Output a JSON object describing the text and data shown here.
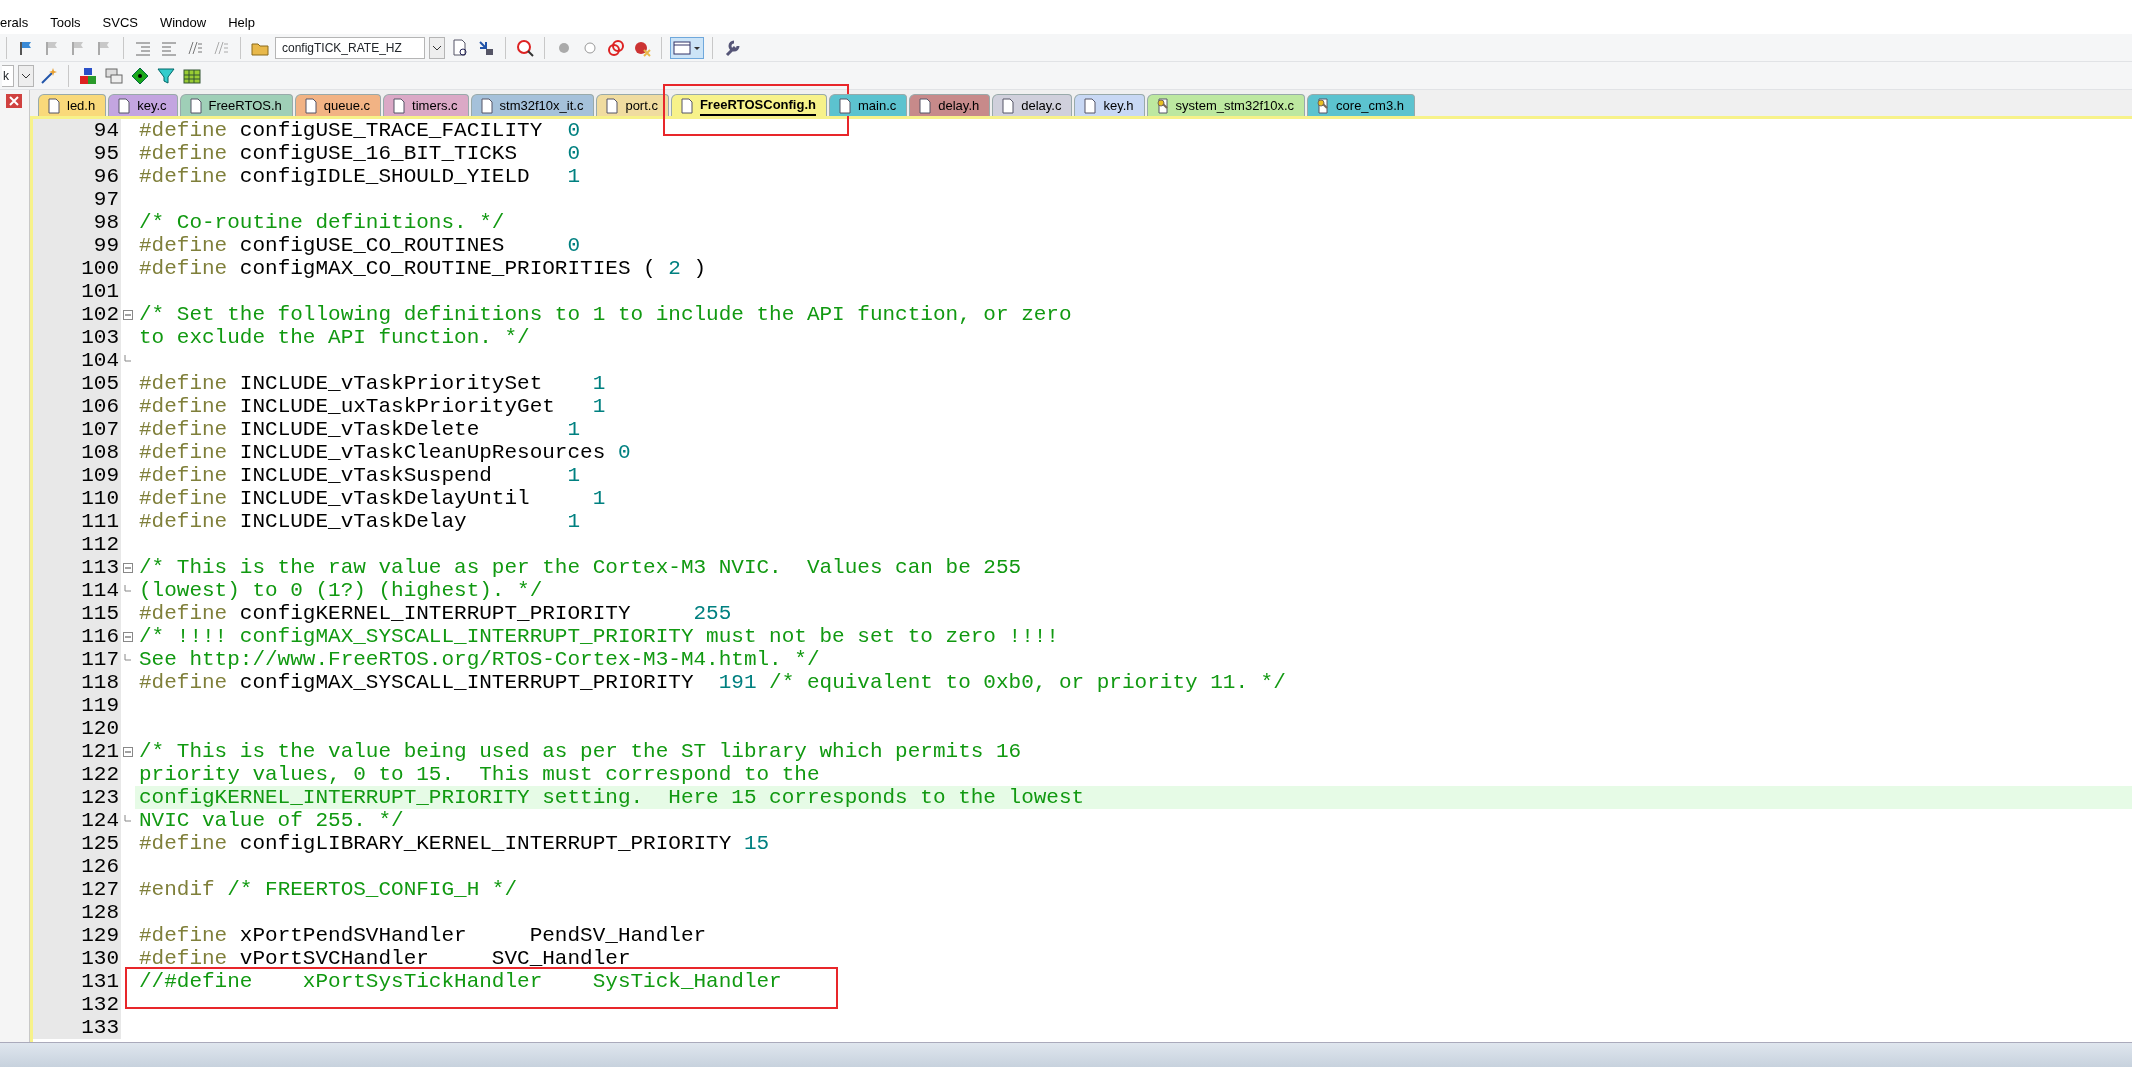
{
  "menu": [
    "erals",
    "Tools",
    "SVCS",
    "Window",
    "Help"
  ],
  "toolbar": {
    "find_combo": "configTICK_RATE_HZ",
    "target_combo": "k"
  },
  "tabs": [
    {
      "label": "led.h",
      "kind": "file",
      "color": "#f9d97a",
      "selected": false,
      "boxed": false
    },
    {
      "label": "key.c",
      "kind": "file",
      "color": "#c3a5e0",
      "selected": false,
      "boxed": false
    },
    {
      "label": "FreeRTOS.h",
      "kind": "file",
      "color": "#9fcfb7",
      "selected": false,
      "boxed": false
    },
    {
      "label": "queue.c",
      "kind": "file",
      "color": "#f2b384",
      "selected": false,
      "boxed": false
    },
    {
      "label": "timers.c",
      "kind": "file",
      "color": "#dba9c6",
      "selected": false,
      "boxed": false
    },
    {
      "label": "stm32f10x_it.c",
      "kind": "file",
      "color": "#a5c1da",
      "selected": false,
      "boxed": false
    },
    {
      "label": "port.c",
      "kind": "file",
      "color": "#f0dca0",
      "selected": false,
      "boxed": false
    },
    {
      "label": "FreeRTOSConfig.h",
      "kind": "file",
      "color": "#f7f28a",
      "selected": true,
      "boxed": true
    },
    {
      "label": "main.c",
      "kind": "file",
      "color": "#5cc3cf",
      "selected": false,
      "boxed": false
    },
    {
      "label": "delay.h",
      "kind": "file",
      "color": "#c78a8a",
      "selected": false,
      "boxed": false
    },
    {
      "label": "delay.c",
      "kind": "file",
      "color": "#d0d0dc",
      "selected": false,
      "boxed": false
    },
    {
      "label": "key.h",
      "kind": "file",
      "color": "#c8d8f4",
      "selected": false,
      "boxed": false
    },
    {
      "label": "system_stm32f10x.c",
      "kind": "key",
      "color": "#bde8a0",
      "selected": false,
      "boxed": false
    },
    {
      "label": "core_cm3.h",
      "kind": "key",
      "color": "#5cc3cf",
      "selected": false,
      "boxed": false
    }
  ],
  "lines": [
    {
      "number": "94",
      "current": false,
      "boxed": false,
      "segments": [
        {
          "kind": "pp",
          "text": "#define"
        },
        {
          "kind": "id",
          "text": " configUSE_TRACE_FACILITY  "
        },
        {
          "kind": "num",
          "text": "0"
        }
      ]
    },
    {
      "number": "95",
      "current": false,
      "boxed": false,
      "segments": [
        {
          "kind": "pp",
          "text": "#define"
        },
        {
          "kind": "id",
          "text": " configUSE_16_BIT_TICKS    "
        },
        {
          "kind": "num",
          "text": "0"
        }
      ]
    },
    {
      "number": "96",
      "current": false,
      "boxed": false,
      "segments": [
        {
          "kind": "pp",
          "text": "#define"
        },
        {
          "kind": "id",
          "text": " configIDLE_SHOULD_YIELD   "
        },
        {
          "kind": "num",
          "text": "1"
        }
      ]
    },
    {
      "number": "97",
      "current": false,
      "boxed": false
    },
    {
      "number": "98",
      "current": false,
      "boxed": false,
      "segments": [
        {
          "kind": "cm",
          "text": "/* Co-routine definitions. */"
        }
      ]
    },
    {
      "number": "99",
      "current": false,
      "boxed": false,
      "segments": [
        {
          "kind": "pp",
          "text": "#define"
        },
        {
          "kind": "id",
          "text": " configUSE_CO_ROUTINES     "
        },
        {
          "kind": "num",
          "text": "0"
        }
      ]
    },
    {
      "number": "100",
      "current": false,
      "boxed": false,
      "segments": [
        {
          "kind": "pp",
          "text": "#define"
        },
        {
          "kind": "id",
          "text": " configMAX_CO_ROUTINE_PRIORITIES ( "
        },
        {
          "kind": "num",
          "text": "2"
        },
        {
          "kind": "id",
          "text": " )"
        }
      ]
    },
    {
      "number": "101",
      "current": false,
      "boxed": false
    },
    {
      "number": "102",
      "fold_start": true,
      "current": false,
      "boxed": false,
      "segments": [
        {
          "kind": "cm",
          "text": "/* Set the following definitions to 1 to include the API function, or zero"
        }
      ]
    },
    {
      "number": "103",
      "current": false,
      "boxed": false,
      "segments": [
        {
          "kind": "cm",
          "text": "to exclude the API function. */"
        }
      ]
    },
    {
      "number": "104",
      "fold_end": true,
      "current": false,
      "boxed": false
    },
    {
      "number": "105",
      "current": false,
      "boxed": false,
      "segments": [
        {
          "kind": "pp",
          "text": "#define"
        },
        {
          "kind": "id",
          "text": " INCLUDE_vTaskPrioritySet    "
        },
        {
          "kind": "num",
          "text": "1"
        }
      ]
    },
    {
      "number": "106",
      "current": false,
      "boxed": false,
      "segments": [
        {
          "kind": "pp",
          "text": "#define"
        },
        {
          "kind": "id",
          "text": " INCLUDE_uxTaskPriorityGet   "
        },
        {
          "kind": "num",
          "text": "1"
        }
      ]
    },
    {
      "number": "107",
      "current": false,
      "boxed": false,
      "segments": [
        {
          "kind": "pp",
          "text": "#define"
        },
        {
          "kind": "id",
          "text": " INCLUDE_vTaskDelete       "
        },
        {
          "kind": "num",
          "text": "1"
        }
      ]
    },
    {
      "number": "108",
      "current": false,
      "boxed": false,
      "segments": [
        {
          "kind": "pp",
          "text": "#define"
        },
        {
          "kind": "id",
          "text": " INCLUDE_vTaskCleanUpResources "
        },
        {
          "kind": "num",
          "text": "0"
        }
      ]
    },
    {
      "number": "109",
      "current": false,
      "boxed": false,
      "segments": [
        {
          "kind": "pp",
          "text": "#define"
        },
        {
          "kind": "id",
          "text": " INCLUDE_vTaskSuspend      "
        },
        {
          "kind": "num",
          "text": "1"
        }
      ]
    },
    {
      "number": "110",
      "current": false,
      "boxed": false,
      "segments": [
        {
          "kind": "pp",
          "text": "#define"
        },
        {
          "kind": "id",
          "text": " INCLUDE_vTaskDelayUntil     "
        },
        {
          "kind": "num",
          "text": "1"
        }
      ]
    },
    {
      "number": "111",
      "current": false,
      "boxed": false,
      "segments": [
        {
          "kind": "pp",
          "text": "#define"
        },
        {
          "kind": "id",
          "text": " INCLUDE_vTaskDelay        "
        },
        {
          "kind": "num",
          "text": "1"
        }
      ]
    },
    {
      "number": "112",
      "current": false,
      "boxed": false
    },
    {
      "number": "113",
      "fold_start": true,
      "current": false,
      "boxed": false,
      "segments": [
        {
          "kind": "cm",
          "text": "/* This is the raw value as per the Cortex-M3 NVIC.  Values can be 255"
        }
      ]
    },
    {
      "number": "114",
      "fold_end": true,
      "current": false,
      "boxed": false,
      "segments": [
        {
          "kind": "cm",
          "text": "(lowest) to 0 (1?) (highest). */"
        }
      ]
    },
    {
      "number": "115",
      "current": false,
      "boxed": false,
      "segments": [
        {
          "kind": "pp",
          "text": "#define"
        },
        {
          "kind": "id",
          "text": " configKERNEL_INTERRUPT_PRIORITY     "
        },
        {
          "kind": "num",
          "text": "255"
        }
      ]
    },
    {
      "number": "116",
      "fold_start": true,
      "current": false,
      "boxed": false,
      "segments": [
        {
          "kind": "cm",
          "text": "/* !!!! configMAX_SYSCALL_INTERRUPT_PRIORITY must not be set to zero !!!!"
        }
      ]
    },
    {
      "number": "117",
      "fold_end": true,
      "current": false,
      "boxed": false,
      "segments": [
        {
          "kind": "cm",
          "text": "See http://www.FreeRTOS.org/RTOS-Cortex-M3-M4.html. */"
        }
      ]
    },
    {
      "number": "118",
      "current": false,
      "boxed": false,
      "segments": [
        {
          "kind": "pp",
          "text": "#define"
        },
        {
          "kind": "id",
          "text": " configMAX_SYSCALL_INTERRUPT_PRIORITY  "
        },
        {
          "kind": "num",
          "text": "191"
        },
        {
          "kind": "cm",
          "text": " /* equivalent to 0xb0, or priority 11. */"
        }
      ]
    },
    {
      "number": "119",
      "current": false,
      "boxed": false
    },
    {
      "number": "120",
      "current": false,
      "boxed": false
    },
    {
      "number": "121",
      "fold_start": true,
      "current": false,
      "boxed": false,
      "segments": [
        {
          "kind": "cm",
          "text": "/* This is the value being used as per the ST library which permits 16"
        }
      ]
    },
    {
      "number": "122",
      "current": false,
      "boxed": false,
      "segments": [
        {
          "kind": "cm",
          "text": "priority values, 0 to 15.  This must correspond to the"
        }
      ]
    },
    {
      "number": "123",
      "current": true,
      "boxed": false,
      "segments": [
        {
          "kind": "cm",
          "text": "configKERNEL_INTERRUPT_PRIORITY setting.  Here 15 corresponds to the lowest"
        }
      ]
    },
    {
      "number": "124",
      "fold_end": true,
      "current": false,
      "boxed": false,
      "segments": [
        {
          "kind": "cm",
          "text": "NVIC value of 255. */"
        }
      ]
    },
    {
      "number": "125",
      "current": false,
      "boxed": false,
      "segments": [
        {
          "kind": "pp",
          "text": "#define"
        },
        {
          "kind": "id",
          "text": " configLIBRARY_KERNEL_INTERRUPT_PRIORITY "
        },
        {
          "kind": "num",
          "text": "15"
        }
      ]
    },
    {
      "number": "126",
      "current": false,
      "boxed": false
    },
    {
      "number": "127",
      "current": false,
      "boxed": false,
      "segments": [
        {
          "kind": "pp",
          "text": "#endif"
        },
        {
          "kind": "cm",
          "text": " /* FREERTOS_CONFIG_H */"
        }
      ]
    },
    {
      "number": "128",
      "current": false,
      "boxed": false
    },
    {
      "number": "129",
      "current": false,
      "boxed": false,
      "segments": [
        {
          "kind": "pp",
          "text": "#define"
        },
        {
          "kind": "id",
          "text": " xPortPendSVHandler     PendSV_Handler"
        }
      ]
    },
    {
      "number": "130",
      "current": false,
      "boxed": false,
      "segments": [
        {
          "kind": "pp",
          "text": "#define"
        },
        {
          "kind": "id",
          "text": " vPortSVCHandler     SVC_Handler"
        }
      ]
    },
    {
      "number": "131",
      "current": false,
      "boxed": true,
      "segments": [
        {
          "kind": "cm",
          "text": "//#define    xPortSysTickHandler    SysTick_Handler"
        }
      ]
    },
    {
      "number": "132",
      "current": false,
      "boxed": false
    },
    {
      "number": "133",
      "current": false,
      "boxed": false
    }
  ]
}
